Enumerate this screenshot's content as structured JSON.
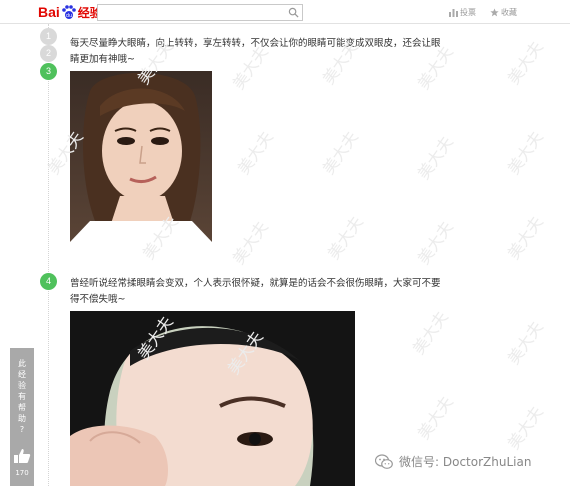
{
  "header": {
    "logo_part1": "Bai",
    "logo_part2": "经验",
    "search_placeholder": "",
    "link_vote": "投票",
    "link_fav": "收藏"
  },
  "steps": [
    {
      "num": "1",
      "state": "done"
    },
    {
      "num": "2",
      "state": "done"
    },
    {
      "num": "3",
      "state": "active"
    },
    {
      "num": "4",
      "state": "active"
    }
  ],
  "step3": {
    "line1": "每天尽量睁大眼睛，向上转转，享左转转，不仅会让你的眼睛可能变成双眼皮，还会让眼",
    "line2": "睛更加有神哦~"
  },
  "step4": {
    "line1": "曾经听说经常揉眼睛会变双，个人表示很怀疑，就算是的话会不会很伤眼睛，大家可不要",
    "line2": "得不偿失哦~"
  },
  "sidebar": {
    "vote_chars": [
      "此",
      "经",
      "验",
      "有",
      "帮",
      "助",
      "?"
    ],
    "vote_count": "170"
  },
  "watermark": {
    "text": "美大夫",
    "wechat": "微信号: DoctorZhuLian"
  },
  "colors": {
    "brand_red": "#e10601",
    "step_green": "#4fc15c",
    "step_gray": "#d9d9d9"
  }
}
